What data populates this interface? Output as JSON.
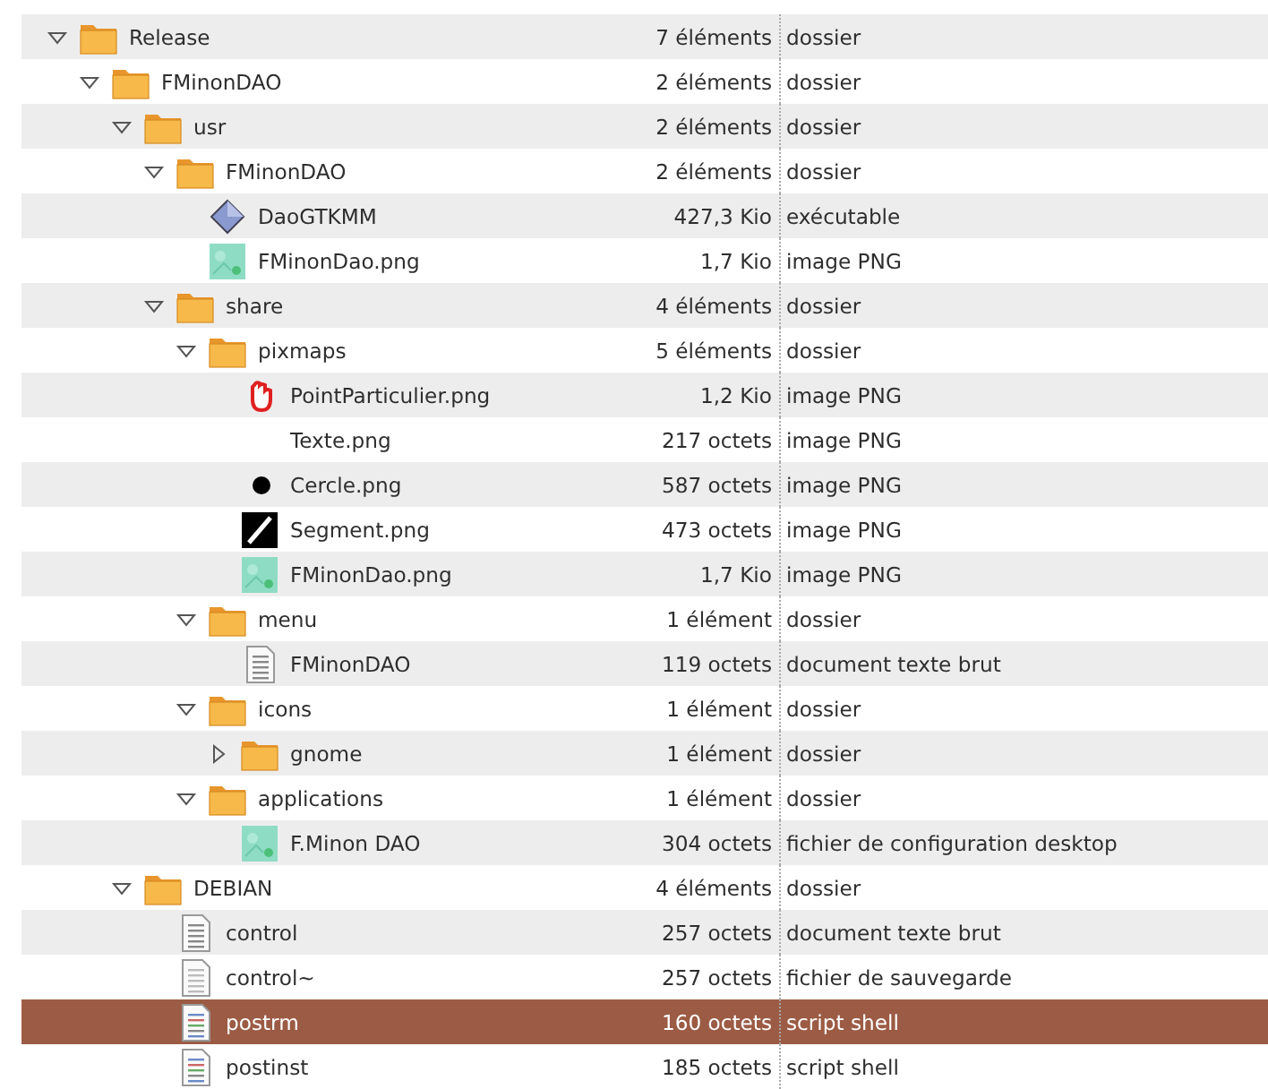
{
  "tree": [
    {
      "name": "Release",
      "kind": "folder",
      "expanded": true,
      "selected": false,
      "size": "7 éléments",
      "type": "dossier",
      "children": [
        {
          "name": "FMinonDAO",
          "kind": "folder",
          "expanded": true,
          "selected": false,
          "size": "2 éléments",
          "type": "dossier",
          "children": [
            {
              "name": "usr",
              "kind": "folder",
              "expanded": true,
              "selected": false,
              "size": "2 éléments",
              "type": "dossier",
              "children": [
                {
                  "name": "FMinonDAO",
                  "kind": "folder",
                  "expanded": true,
                  "selected": false,
                  "size": "2 éléments",
                  "type": "dossier",
                  "children": [
                    {
                      "name": "DaoGTKMM",
                      "kind": "executable",
                      "selected": false,
                      "size": "427,3 Kio",
                      "type": "exécutable"
                    },
                    {
                      "name": "FMinonDao.png",
                      "kind": "image",
                      "selected": false,
                      "size": "1,7 Kio",
                      "type": "image PNG"
                    }
                  ]
                },
                {
                  "name": "share",
                  "kind": "folder",
                  "expanded": true,
                  "selected": false,
                  "size": "4 éléments",
                  "type": "dossier",
                  "children": [
                    {
                      "name": "pixmaps",
                      "kind": "folder",
                      "expanded": true,
                      "selected": false,
                      "size": "5 éléments",
                      "type": "dossier",
                      "children": [
                        {
                          "name": "PointParticulier.png",
                          "kind": "hand",
                          "selected": false,
                          "size": "1,2 Kio",
                          "type": "image PNG"
                        },
                        {
                          "name": "Texte.png",
                          "kind": "blank",
                          "selected": false,
                          "size": "217 octets",
                          "type": "image PNG"
                        },
                        {
                          "name": "Cercle.png",
                          "kind": "circle",
                          "selected": false,
                          "size": "587 octets",
                          "type": "image PNG"
                        },
                        {
                          "name": "Segment.png",
                          "kind": "segment",
                          "selected": false,
                          "size": "473 octets",
                          "type": "image PNG"
                        },
                        {
                          "name": "FMinonDao.png",
                          "kind": "image",
                          "selected": false,
                          "size": "1,7 Kio",
                          "type": "image PNG"
                        }
                      ]
                    },
                    {
                      "name": "menu",
                      "kind": "folder",
                      "expanded": true,
                      "selected": false,
                      "size": "1 élément",
                      "type": "dossier",
                      "children": [
                        {
                          "name": "FMinonDAO",
                          "kind": "text",
                          "selected": false,
                          "size": "119 octets",
                          "type": "document texte brut"
                        }
                      ]
                    },
                    {
                      "name": "icons",
                      "kind": "folder",
                      "expanded": true,
                      "selected": false,
                      "size": "1 élément",
                      "type": "dossier",
                      "children": [
                        {
                          "name": "gnome",
                          "kind": "folder",
                          "expanded": false,
                          "selected": false,
                          "size": "1 élément",
                          "type": "dossier"
                        }
                      ]
                    },
                    {
                      "name": "applications",
                      "kind": "folder",
                      "expanded": true,
                      "selected": false,
                      "size": "1 élément",
                      "type": "dossier",
                      "children": [
                        {
                          "name": "F.Minon DAO",
                          "kind": "image",
                          "selected": false,
                          "size": "304 octets",
                          "type": "fichier de configuration desktop"
                        }
                      ]
                    }
                  ]
                }
              ]
            },
            {
              "name": "DEBIAN",
              "kind": "folder",
              "expanded": true,
              "selected": false,
              "size": "4 éléments",
              "type": "dossier",
              "children": [
                {
                  "name": "control",
                  "kind": "text",
                  "selected": false,
                  "size": "257 octets",
                  "type": "document texte brut"
                },
                {
                  "name": "control~",
                  "kind": "backup",
                  "selected": false,
                  "size": "257 octets",
                  "type": "fichier de sauvegarde"
                },
                {
                  "name": "postrm",
                  "kind": "script",
                  "selected": true,
                  "size": "160 octets",
                  "type": "script shell"
                },
                {
                  "name": "postinst",
                  "kind": "script",
                  "selected": false,
                  "size": "185 octets",
                  "type": "script shell"
                }
              ]
            }
          ]
        }
      ]
    }
  ]
}
